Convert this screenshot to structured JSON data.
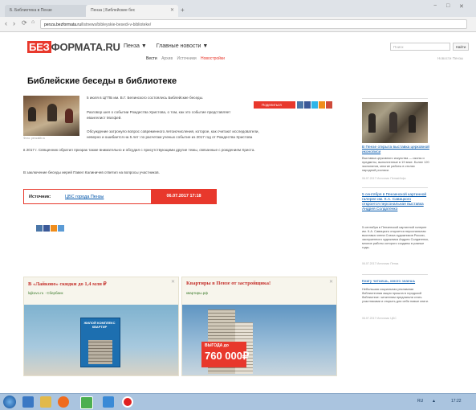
{
  "browser": {
    "tabs": [
      {
        "label": "Б. Библиотека в Пензе",
        "active": false
      },
      {
        "label": "Пенза | Библейские бес",
        "active": true
      }
    ],
    "address": {
      "domain": "penza.bezformata.ru",
      "path": "/listnews/bibleyskie-besedi-v-biblioteke/"
    },
    "window_controls": [
      "−",
      "□",
      "✕"
    ]
  },
  "site": {
    "logo_mark": "БЕЗ",
    "logo_text": "ФОРМАТА.RU",
    "nav_primary": [
      {
        "label": "Пенза ▼"
      },
      {
        "label": "Главные новости ▼"
      }
    ],
    "nav_secondary": [
      {
        "label": "Вести",
        "style": "act"
      },
      {
        "label": "Архив",
        "style": ""
      },
      {
        "label": "Источники",
        "style": ""
      },
      {
        "label": "Новостройки",
        "style": "red"
      }
    ],
    "search_placeholder": "Поиск",
    "search_button": "Найти",
    "top_link": "Новости Пензы"
  },
  "article": {
    "title": "Библейские беседы в библиотеке",
    "photo_caption": "Фото: penzalib.ru",
    "p1": "5 июля в ЦГПБ им. В.Г. Белинского состоялись Библейские беседы.",
    "p2": "Разговор шел о событии Рождества Христова, о том, как это событие представляет евангелист Матфей.",
    "p3": "Обсуждение затронуло вопрос современного летоисчисления, которое, как считают исследователи, неверно и ошибается на 5 лет: по расчетам ученых событие из 2017 год от Рождества Христова",
    "p4": "в 2017 г. Священник обратил призрак также внимательно и обсудил с присутствующими другие темы, связанные с рождением Христа.",
    "p5": "В заключение беседы иерей Павел Калиничев ответил на вопросы участников.",
    "share_label": "Поделиться",
    "source_label": "Источник:",
    "source_link": "ЦБС города Пензы",
    "source_date": "06.07.2017  17:18"
  },
  "sidebar": [
    {
      "title": "В Пензе открыта выставка церковной иконописи",
      "text": "Выставка церковного искусства — иконы и предметы, выполненные в 19 веке. Более 120 экспонатов, многие работы в стилях народной росписи.",
      "date": "06.07.2017 Источник: ПензаИнфо"
    },
    {
      "title": "5 сентября в Пензенской картинной галерее им. К.А. Савицкого откроется персональная выставка Андрея Солдатенко",
      "text": "5 сентября в Пензенской картинной галерее им. К.А. Савицкого откроется персональная выставка члена Союза художников России, заслуженного художника Андрея Солдатенко, многие работы которого созданы в разные годы.",
      "date": "06.07.2017 Источник: Пенза"
    },
    {
      "title": "Книгу читаешь, много знаешь",
      "text": "Небольшая социальная рекламная библиотечная акция прошла в городской библиотеке: читателям предлагали стать участниками и открыть для себя новые книги.",
      "date": "06.07.2017 Источник: ЦБС"
    }
  ],
  "ads": [
    {
      "title": "В «Лайково» скидки до 1,4 млн ₽",
      "url": "lajkovo.ru · Сбербанк",
      "image_text": "ЖИЛОЙ КОМПЛЕКС КВАРТИР"
    },
    {
      "title": "Квартиры в Пензе от застройщика!",
      "url": "квартиры.рф",
      "image_text": "ВЫГОДА до",
      "image_price": "760 000₽"
    }
  ],
  "taskbar": {
    "tray_text": "RU",
    "clock": "17:22"
  },
  "colors": {
    "brand_red": "#e8382c",
    "link_blue": "#0055aa"
  }
}
